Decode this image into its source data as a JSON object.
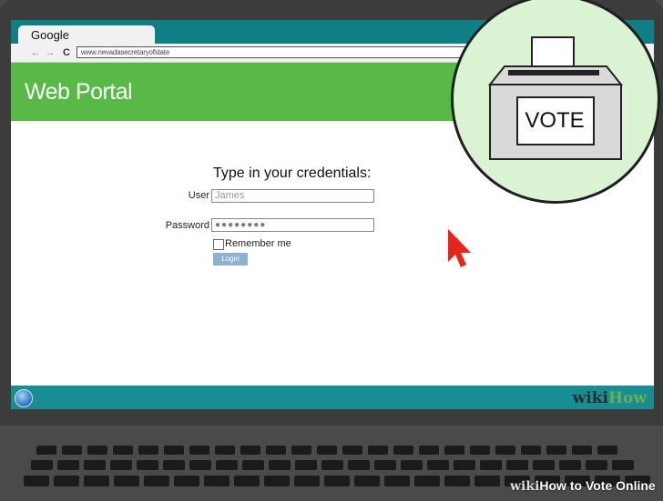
{
  "browser": {
    "tab_title": "Google",
    "url": "www.nevadasecretaryofstate",
    "nav": {
      "back": "←",
      "forward": "→",
      "refresh": "C"
    }
  },
  "portal": {
    "title": "Web Portal"
  },
  "form": {
    "heading": "Type in your credentials:",
    "user_label": "User",
    "user_value": "James",
    "password_label": "Password",
    "password_value": "●●●●●●●●",
    "remember_label": "Remember me",
    "login_label": "Login"
  },
  "vote_box": {
    "label": "VOTE"
  },
  "watermark": {
    "wiki": "wiki",
    "how": "How"
  },
  "footer": {
    "wiki": "wiki",
    "how": "How",
    "rest": " to Vote Online"
  }
}
